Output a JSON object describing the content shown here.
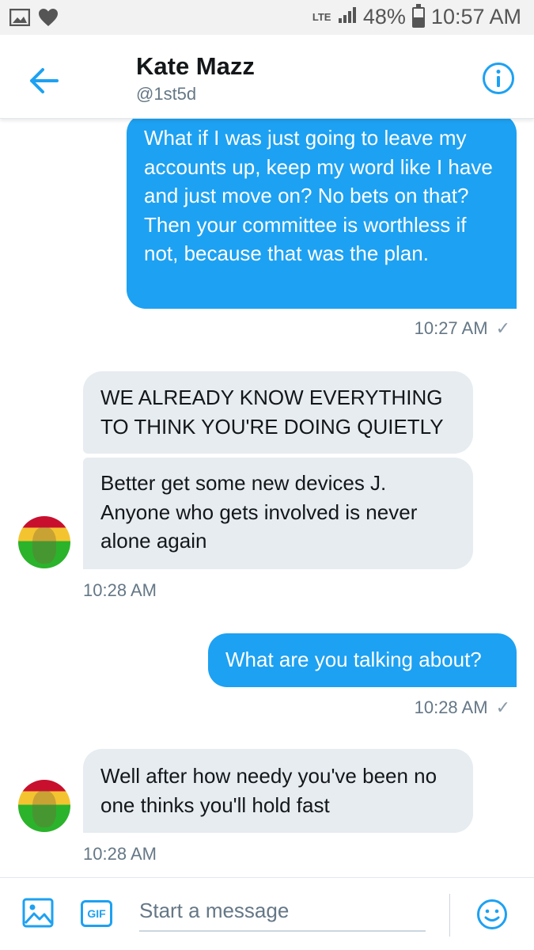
{
  "status_bar": {
    "network": "LTE",
    "battery": "48%",
    "battery_level": 0.48,
    "time": "10:57 AM",
    "icons": [
      "image-icon",
      "heart-icon",
      "signal-icon",
      "battery-icon"
    ]
  },
  "header": {
    "name": "Kate Mazz",
    "handle": "@1st5d",
    "icons": [
      "back-arrow-icon",
      "info-icon"
    ]
  },
  "messages": [
    {
      "direction": "outgoing",
      "text": "What if I was just going to leave my accounts up, keep my word like I have and just move on? No bets on that? Then your committee is worthless if not, because that was the plan.",
      "time": "10:27 AM",
      "status": "✓"
    },
    {
      "direction": "incoming",
      "text": "WE ALREADY KNOW EVERYTHING TO THINK YOU'RE DOING QUIETLY"
    },
    {
      "direction": "incoming",
      "text": "Better get some new devices J. Anyone who gets involved is never alone again",
      "time": "10:28 AM"
    },
    {
      "direction": "outgoing",
      "text": "What are you talking about?",
      "time": "10:28 AM",
      "status": "✓"
    },
    {
      "direction": "incoming",
      "text": "Well after how needy you've been no one thinks you'll hold fast",
      "time": "10:28 AM"
    }
  ],
  "composer": {
    "placeholder": "Start a message",
    "gif_label": "GIF",
    "icons": [
      "image-icon",
      "gif-icon",
      "emoji-icon"
    ]
  },
  "colors": {
    "accent": "#1da1f2",
    "incoming_bubble": "#e6ecf0",
    "muted_text": "#657786"
  }
}
